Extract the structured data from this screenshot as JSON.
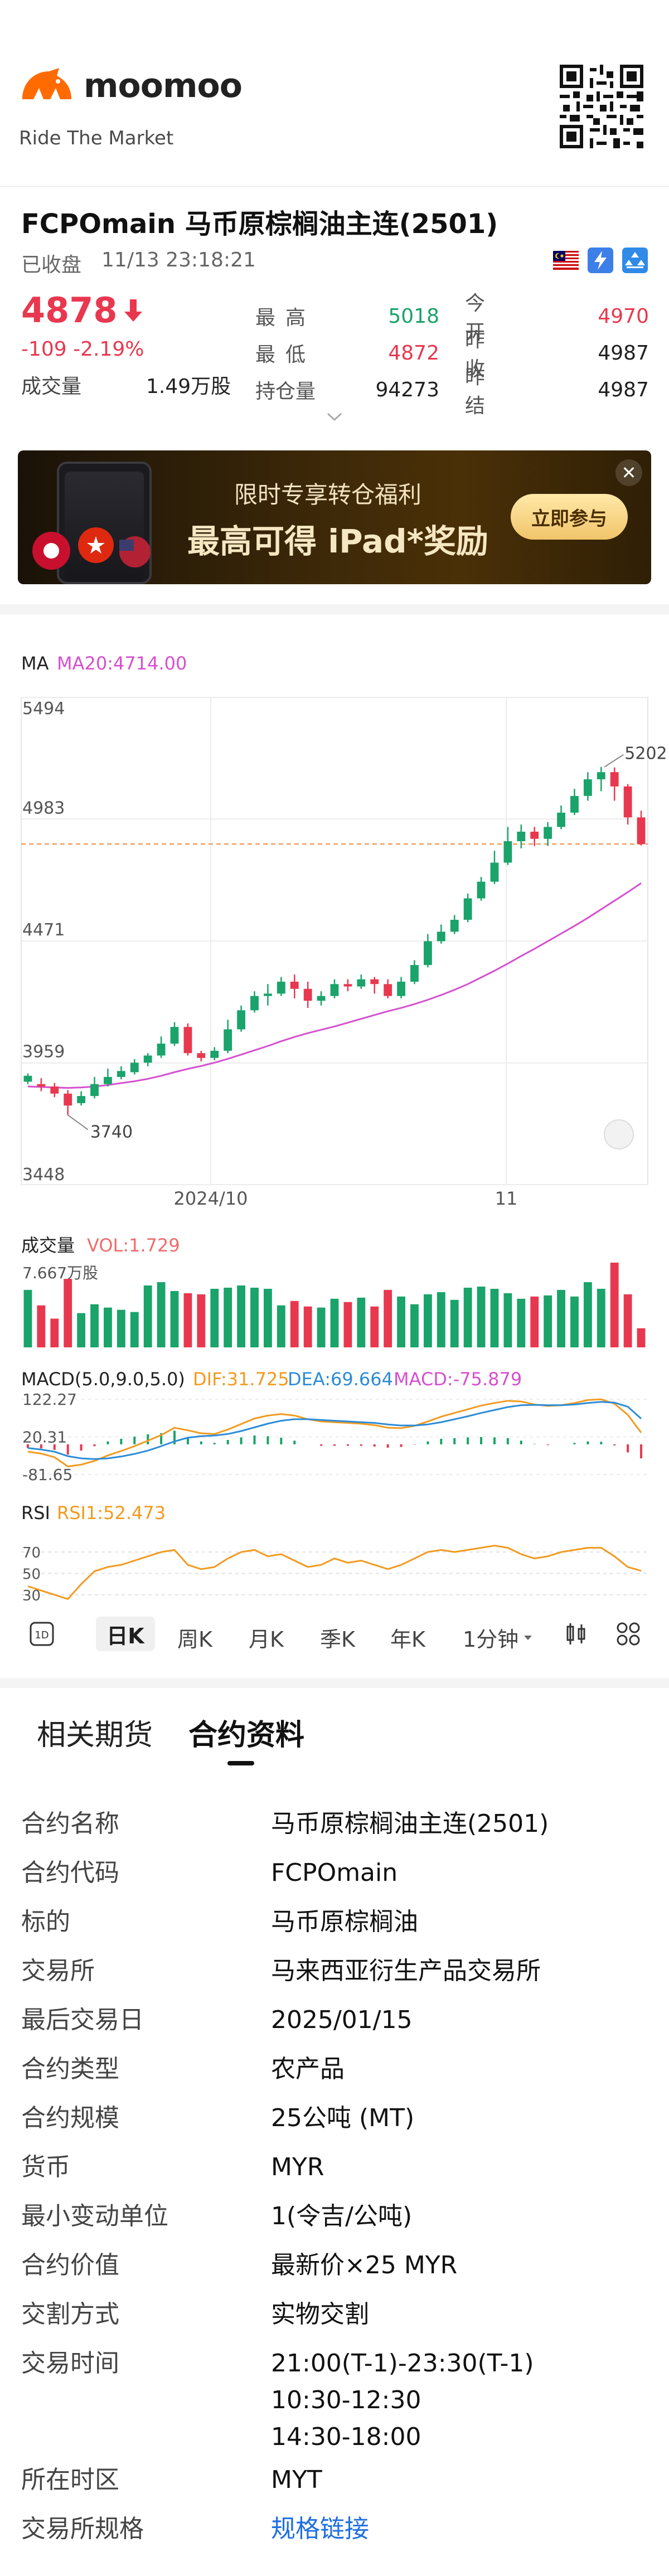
{
  "header": {
    "brand": "moomoo",
    "tagline": "Ride The Market"
  },
  "instrument": {
    "title": "FCPOmain  马币原棕榈油主连(2501)",
    "status": "已收盘",
    "timestamp": "11/13 23:18:21",
    "price": "4878",
    "change": "-109  -2.19%",
    "volume_label": "成交量",
    "volume_value": "1.49万股"
  },
  "stats": [
    {
      "k1": "最高",
      "v1": "5018",
      "k2": "今开",
      "v2": "4970"
    },
    {
      "k1": "最低",
      "v1": "4872",
      "k2": "昨收",
      "v2": "4987"
    },
    {
      "k1": "持仓量",
      "v1": "94273",
      "k2": "昨结",
      "v2": "4987"
    }
  ],
  "banner": {
    "line1": "限时专享转仓福利",
    "line2": "最高可得 iPad*奖励",
    "button": "立即参与",
    "close": "✕"
  },
  "chart_labels": {
    "ma_title": "MA",
    "ma20": "MA20:4714.00",
    "y_ticks": [
      "5494",
      "4983",
      "4471",
      "3959",
      "3448"
    ],
    "x_ticks": [
      "2024/10",
      "11"
    ],
    "high_mark": "5202",
    "low_mark": "3740",
    "vol_title": "成交量",
    "vol_value": "VOL:1.729",
    "vol_max": "7.667万股",
    "macd_title": "MACD(5.0,9.0,5.0)",
    "dif": "DIF:31.725",
    "dea": "DEA:69.664",
    "macd": "MACD:-75.879",
    "macd_ticks": [
      "122.27",
      "20.31",
      "-81.65"
    ],
    "rsi_title": "RSI",
    "rsi1": "RSI1:52.473",
    "rsi_ticks": [
      "70",
      "50",
      "30"
    ]
  },
  "period_tabs": [
    "1D",
    "日K",
    "周K",
    "月K",
    "季K",
    "年K",
    "1分钟"
  ],
  "section_tabs": [
    "相关期货",
    "合约资料"
  ],
  "contract_info": [
    {
      "k": "合约名称",
      "v": "马币原棕榈油主连(2501)"
    },
    {
      "k": "合约代码",
      "v": "FCPOmain"
    },
    {
      "k": "标的",
      "v": "马币原棕榈油"
    },
    {
      "k": "交易所",
      "v": "马来西亚衍生产品交易所"
    },
    {
      "k": "最后交易日",
      "v": "2025/01/15"
    },
    {
      "k": "合约类型",
      "v": "农产品"
    },
    {
      "k": "合约规模",
      "v": "25公吨 (MT)"
    },
    {
      "k": "货币",
      "v": "MYR"
    },
    {
      "k": "最小变动单位",
      "v": "1(令吉/公吨)"
    },
    {
      "k": "合约价值",
      "v": "最新价×25 MYR"
    },
    {
      "k": "交割方式",
      "v": "实物交割"
    },
    {
      "k": "交易时间",
      "v": "21:00(T-1)-23:30(T-1)\n10:30-12:30\n14:30-18:00"
    },
    {
      "k": "所在时区",
      "v": "MYT"
    },
    {
      "k": "交易所规格",
      "v": "规格链接"
    }
  ],
  "colors": {
    "up": "#1aa36a",
    "down": "#e8384f",
    "ma": "#d64fd0",
    "brand_orange": "#ff6b00",
    "link": "#1f6fe0"
  },
  "chart_data": {
    "type": "candlestick",
    "ylim": [
      3448,
      5494
    ],
    "candles": [
      [
        3880,
        3905,
        3870,
        3915
      ],
      [
        3870,
        3860,
        3840,
        3895
      ],
      [
        3860,
        3830,
        3815,
        3875
      ],
      [
        3830,
        3780,
        3740,
        3845
      ],
      [
        3790,
        3820,
        3780,
        3840
      ],
      [
        3820,
        3870,
        3810,
        3900
      ],
      [
        3870,
        3900,
        3860,
        3935
      ],
      [
        3900,
        3925,
        3890,
        3945
      ],
      [
        3920,
        3960,
        3910,
        3975
      ],
      [
        3960,
        3990,
        3945,
        4000
      ],
      [
        3990,
        4040,
        3980,
        4070
      ],
      [
        4040,
        4110,
        4030,
        4130
      ],
      [
        4110,
        4000,
        3990,
        4125
      ],
      [
        4000,
        3980,
        3965,
        4010
      ],
      [
        3980,
        4010,
        3970,
        4025
      ],
      [
        4010,
        4100,
        4000,
        4140
      ],
      [
        4100,
        4180,
        4090,
        4200
      ],
      [
        4180,
        4240,
        4170,
        4260
      ],
      [
        4240,
        4250,
        4200,
        4290
      ],
      [
        4250,
        4300,
        4240,
        4320
      ],
      [
        4300,
        4270,
        4230,
        4330
      ],
      [
        4270,
        4220,
        4190,
        4300
      ],
      [
        4220,
        4240,
        4200,
        4260
      ],
      [
        4240,
        4290,
        4230,
        4310
      ],
      [
        4290,
        4280,
        4260,
        4310
      ],
      [
        4280,
        4310,
        4270,
        4330
      ],
      [
        4310,
        4290,
        4250,
        4320
      ],
      [
        4290,
        4240,
        4230,
        4310
      ],
      [
        4240,
        4300,
        4230,
        4320
      ],
      [
        4300,
        4370,
        4290,
        4390
      ],
      [
        4370,
        4470,
        4360,
        4500
      ],
      [
        4470,
        4510,
        4460,
        4540
      ],
      [
        4510,
        4560,
        4500,
        4580
      ],
      [
        4560,
        4650,
        4550,
        4670
      ],
      [
        4650,
        4720,
        4640,
        4740
      ],
      [
        4720,
        4800,
        4710,
        4850
      ],
      [
        4800,
        4890,
        4790,
        4950
      ],
      [
        4890,
        4930,
        4860,
        4960
      ],
      [
        4930,
        4900,
        4870,
        4950
      ],
      [
        4900,
        4950,
        4870,
        4970
      ],
      [
        4950,
        5010,
        4940,
        5040
      ],
      [
        5010,
        5080,
        5000,
        5110
      ],
      [
        5080,
        5150,
        5060,
        5180
      ],
      [
        5150,
        5180,
        5100,
        5202
      ],
      [
        5180,
        5120,
        5060,
        5200
      ],
      [
        5120,
        4990,
        4960,
        5130
      ],
      [
        4990,
        4878,
        4872,
        5018
      ]
    ],
    "ma20": [
      3860,
      3858,
      3856,
      3854,
      3856,
      3860,
      3866,
      3874,
      3882,
      3892,
      3905,
      3920,
      3934,
      3946,
      3960,
      3976,
      3994,
      4012,
      4030,
      4050,
      4068,
      4084,
      4098,
      4112,
      4128,
      4144,
      4160,
      4176,
      4190,
      4206,
      4224,
      4244,
      4266,
      4290,
      4318,
      4346,
      4376,
      4408,
      4438,
      4470,
      4502,
      4534,
      4568,
      4604,
      4640,
      4676,
      4714
    ],
    "volume": [
      5.2,
      3.8,
      2.6,
      6.2,
      3.1,
      3.9,
      3.6,
      3.4,
      3.2,
      5.6,
      5.9,
      5.1,
      4.9,
      4.8,
      5.3,
      5.4,
      5.6,
      5.4,
      5.3,
      3.8,
      4.2,
      3.7,
      3.6,
      4.4,
      4.1,
      4.5,
      3.7,
      5.2,
      4.6,
      3.9,
      4.8,
      5.0,
      4.3,
      5.4,
      5.5,
      5.3,
      4.9,
      4.4,
      4.6,
      4.7,
      5.2,
      4.6,
      5.9,
      5.3,
      7.667,
      4.8,
      1.729
    ],
    "macd_dif": [
      -20,
      -25,
      -35,
      -60,
      -55,
      -45,
      -30,
      -18,
      -5,
      10,
      25,
      45,
      38,
      30,
      28,
      40,
      55,
      70,
      78,
      82,
      78,
      68,
      62,
      60,
      58,
      56,
      52,
      45,
      44,
      50,
      62,
      75,
      85,
      95,
      105,
      112,
      118,
      116,
      108,
      104,
      106,
      112,
      120,
      122,
      110,
      80,
      31.725
    ],
    "macd_dea": [
      -10,
      -14,
      -20,
      -32,
      -38,
      -40,
      -38,
      -33,
      -26,
      -17,
      -5,
      8,
      18,
      22,
      24,
      28,
      36,
      46,
      56,
      64,
      68,
      68,
      66,
      64,
      62,
      60,
      58,
      54,
      51,
      51,
      54,
      60,
      68,
      76,
      85,
      93,
      101,
      106,
      107,
      106,
      106,
      108,
      112,
      115,
      113,
      102,
      69.664
    ],
    "rsi": [
      38,
      34,
      30,
      26,
      40,
      52,
      56,
      58,
      62,
      66,
      70,
      72,
      58,
      54,
      56,
      64,
      70,
      72,
      66,
      68,
      62,
      56,
      58,
      64,
      60,
      62,
      58,
      54,
      58,
      64,
      70,
      72,
      70,
      72,
      74,
      76,
      74,
      68,
      64,
      66,
      70,
      72,
      74,
      74,
      66,
      56,
      52.473
    ]
  }
}
